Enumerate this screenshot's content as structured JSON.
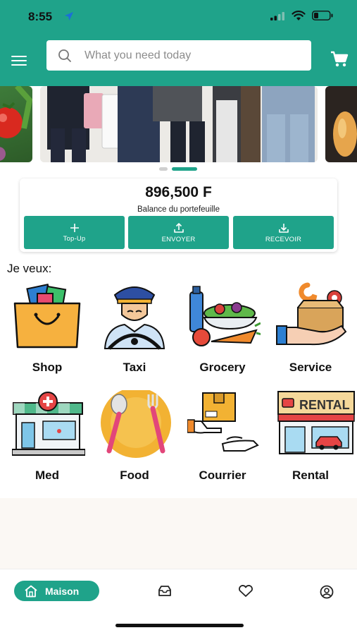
{
  "status_bar": {
    "time": "8:55"
  },
  "search": {
    "placeholder": "What you need today"
  },
  "wallet": {
    "amount": "896,500 F",
    "label": "Balance du portefeuille",
    "buttons": [
      {
        "label": "Top-Up",
        "icon": "plus-icon"
      },
      {
        "label": "ENVOYER",
        "icon": "upload-icon"
      },
      {
        "label": "RECEVOIR",
        "icon": "download-icon"
      }
    ]
  },
  "carousel": {
    "slide_count": 2,
    "active_index": 1
  },
  "section_title": "Je veux:",
  "services": [
    {
      "label": "Shop",
      "icon": "shopping-bag-icon"
    },
    {
      "label": "Taxi",
      "icon": "taxi-driver-icon"
    },
    {
      "label": "Grocery",
      "icon": "grocery-icon"
    },
    {
      "label": "Service",
      "icon": "service-box-icon"
    },
    {
      "label": "Med",
      "icon": "pharmacy-icon"
    },
    {
      "label": "Food",
      "icon": "plate-cutlery-icon"
    },
    {
      "label": "Courrier",
      "icon": "parcel-delivery-icon"
    },
    {
      "label": "Rental",
      "icon": "rental-shop-icon",
      "sign_text": "RENTAL"
    }
  ],
  "tab_bar": {
    "home_label": "Maison",
    "tabs": [
      "home-icon",
      "inbox-icon",
      "heart-icon",
      "profile-icon"
    ]
  },
  "colors": {
    "brand": "#1fa38a",
    "header": "#1fa38a",
    "footer_bg": "#fbf8f4"
  }
}
